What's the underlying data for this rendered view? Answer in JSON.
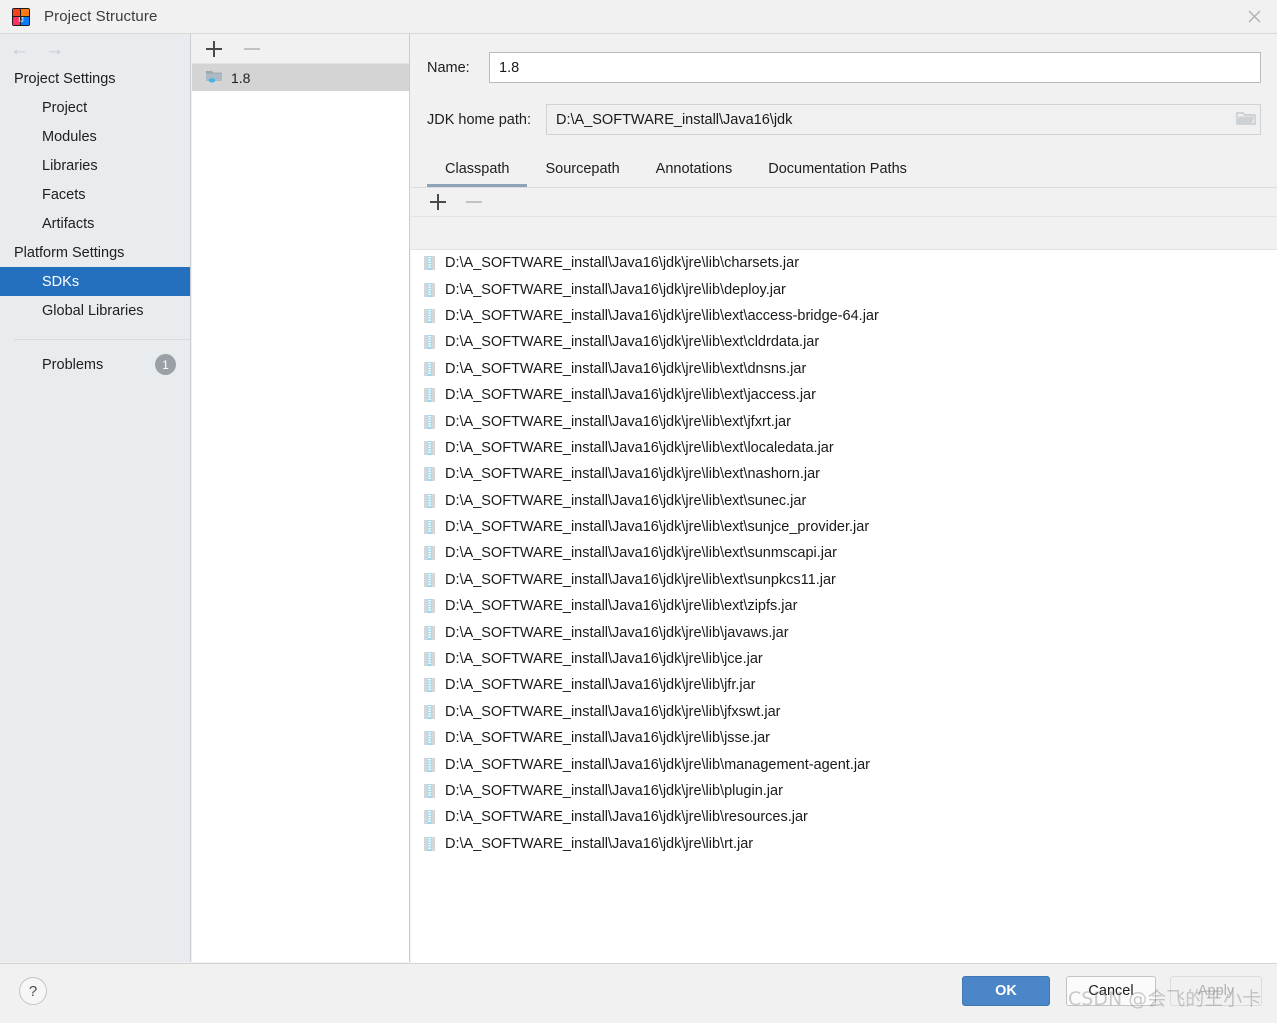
{
  "window": {
    "title": "Project Structure",
    "logo_icon": "intellij-idea-logo",
    "close_icon": "close-icon"
  },
  "sidebar": {
    "back_icon": "arrow-left-icon",
    "forward_icon": "arrow-right-icon",
    "groups": [
      {
        "label": "Project Settings",
        "items": [
          {
            "label": "Project",
            "selected": false
          },
          {
            "label": "Modules",
            "selected": false
          },
          {
            "label": "Libraries",
            "selected": false
          },
          {
            "label": "Facets",
            "selected": false
          },
          {
            "label": "Artifacts",
            "selected": false
          }
        ]
      },
      {
        "label": "Platform Settings",
        "items": [
          {
            "label": "SDKs",
            "selected": true
          },
          {
            "label": "Global Libraries",
            "selected": false
          }
        ]
      }
    ],
    "problems": {
      "label": "Problems",
      "count": "1"
    }
  },
  "tree_panel": {
    "toolbar": {
      "add_icon": "plus-icon",
      "remove_icon": "minus-icon"
    },
    "items": [
      {
        "label": "1.8",
        "icon": "jdk-folder-icon",
        "selected": true
      }
    ]
  },
  "detail": {
    "name_label": "Name:",
    "name_value": "1.8",
    "name_placeholder": "",
    "jdk_home_label": "JDK home path:",
    "jdk_home_value": "D:\\A_SOFTWARE_install\\Java16\\jdk",
    "browse_icon": "folder-browse-icon",
    "tabs": [
      {
        "label": "Classpath",
        "active": true
      },
      {
        "label": "Sourcepath",
        "active": false
      },
      {
        "label": "Annotations",
        "active": false
      },
      {
        "label": "Documentation Paths",
        "active": false
      }
    ],
    "list_toolbar": {
      "add_icon": "plus-icon",
      "remove_icon": "minus-icon"
    },
    "classpath_entries": [
      "D:\\A_SOFTWARE_install\\Java16\\jdk\\jre\\lib\\charsets.jar",
      "D:\\A_SOFTWARE_install\\Java16\\jdk\\jre\\lib\\deploy.jar",
      "D:\\A_SOFTWARE_install\\Java16\\jdk\\jre\\lib\\ext\\access-bridge-64.jar",
      "D:\\A_SOFTWARE_install\\Java16\\jdk\\jre\\lib\\ext\\cldrdata.jar",
      "D:\\A_SOFTWARE_install\\Java16\\jdk\\jre\\lib\\ext\\dnsns.jar",
      "D:\\A_SOFTWARE_install\\Java16\\jdk\\jre\\lib\\ext\\jaccess.jar",
      "D:\\A_SOFTWARE_install\\Java16\\jdk\\jre\\lib\\ext\\jfxrt.jar",
      "D:\\A_SOFTWARE_install\\Java16\\jdk\\jre\\lib\\ext\\localedata.jar",
      "D:\\A_SOFTWARE_install\\Java16\\jdk\\jre\\lib\\ext\\nashorn.jar",
      "D:\\A_SOFTWARE_install\\Java16\\jdk\\jre\\lib\\ext\\sunec.jar",
      "D:\\A_SOFTWARE_install\\Java16\\jdk\\jre\\lib\\ext\\sunjce_provider.jar",
      "D:\\A_SOFTWARE_install\\Java16\\jdk\\jre\\lib\\ext\\sunmscapi.jar",
      "D:\\A_SOFTWARE_install\\Java16\\jdk\\jre\\lib\\ext\\sunpkcs11.jar",
      "D:\\A_SOFTWARE_install\\Java16\\jdk\\jre\\lib\\ext\\zipfs.jar",
      "D:\\A_SOFTWARE_install\\Java16\\jdk\\jre\\lib\\javaws.jar",
      "D:\\A_SOFTWARE_install\\Java16\\jdk\\jre\\lib\\jce.jar",
      "D:\\A_SOFTWARE_install\\Java16\\jdk\\jre\\lib\\jfr.jar",
      "D:\\A_SOFTWARE_install\\Java16\\jdk\\jre\\lib\\jfxswt.jar",
      "D:\\A_SOFTWARE_install\\Java16\\jdk\\jre\\lib\\jsse.jar",
      "D:\\A_SOFTWARE_install\\Java16\\jdk\\jre\\lib\\management-agent.jar",
      "D:\\A_SOFTWARE_install\\Java16\\jdk\\jre\\lib\\plugin.jar",
      "D:\\A_SOFTWARE_install\\Java16\\jdk\\jre\\lib\\resources.jar",
      "D:\\A_SOFTWARE_install\\Java16\\jdk\\jre\\lib\\rt.jar"
    ]
  },
  "footer": {
    "help_label": "?",
    "ok_label": "OK",
    "cancel_label": "Cancel",
    "apply_label": "Apply"
  },
  "watermark": "CSDN @会飞的王小卡",
  "colors": {
    "accent_blue": "#2470bf",
    "ok_button": "#4a86c8",
    "sidebar_bg": "#e8ecef",
    "tab_underline": "#8fa3b8",
    "badge_gray": "#9aa0a6"
  }
}
